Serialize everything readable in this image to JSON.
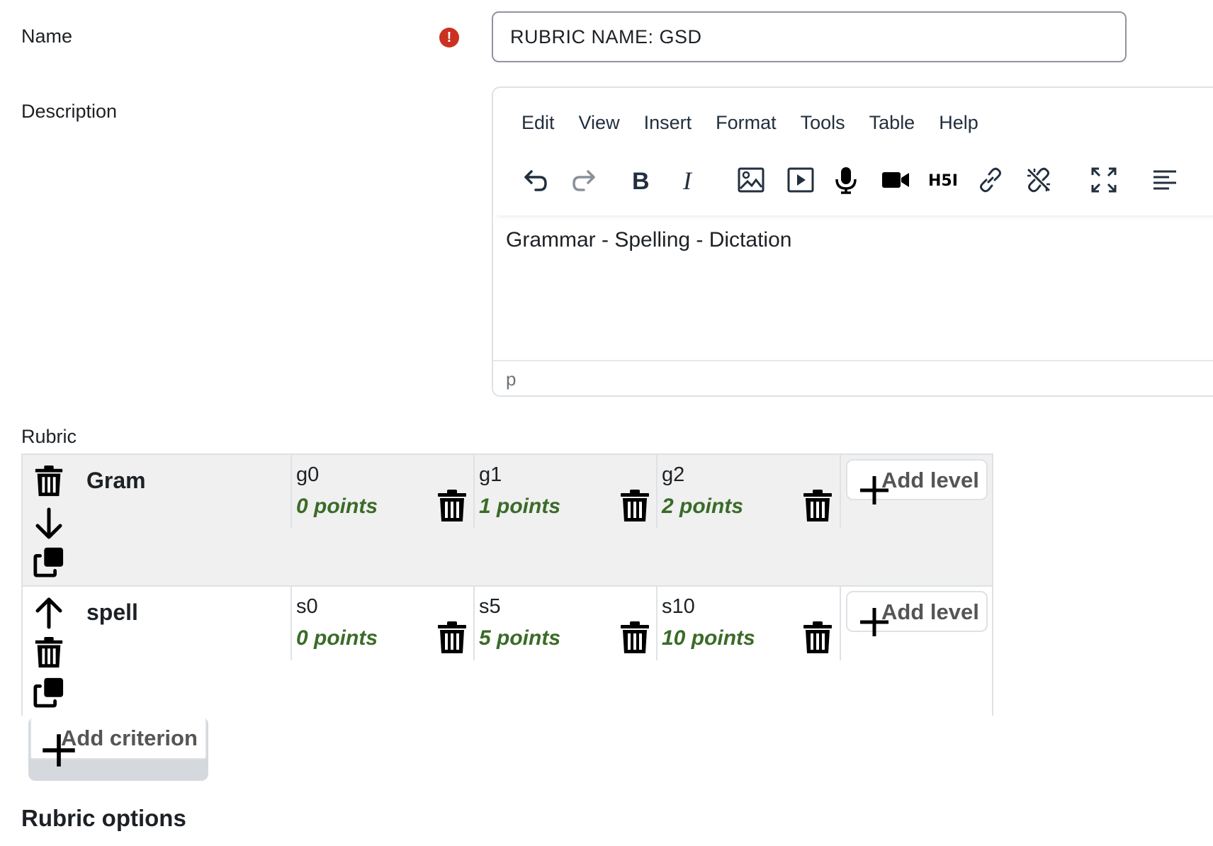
{
  "form": {
    "name_label": "Name",
    "name_value": "RUBRIC NAME: GSD",
    "description_label": "Description",
    "rubric_label": "Rubric",
    "rubric_options_title": "Rubric options"
  },
  "editor": {
    "menu": [
      "Edit",
      "View",
      "Insert",
      "Format",
      "Tools",
      "Table",
      "Help"
    ],
    "content": "Grammar - Spelling - Dictation",
    "status_path": "p",
    "toolbar_icons": [
      "undo-icon",
      "redo-icon",
      "bold-icon",
      "italic-icon",
      "image-icon",
      "media-icon",
      "microphone-icon",
      "video-camera-icon",
      "h5p-icon",
      "link-icon",
      "unlink-icon",
      "fullscreen-icon",
      "align-icon"
    ]
  },
  "rubric": {
    "add_level_label": "Add level",
    "add_criterion_label": "Add criterion",
    "criteria": [
      {
        "name": "Gram",
        "levels": [
          {
            "definition": "g0",
            "points": "0 points"
          },
          {
            "definition": "g1",
            "points": "1 points"
          },
          {
            "definition": "g2",
            "points": "2 points"
          }
        ]
      },
      {
        "name": "spell",
        "levels": [
          {
            "definition": "s0",
            "points": "0 points"
          },
          {
            "definition": "s5",
            "points": "5 points"
          },
          {
            "definition": "s10",
            "points": "10 points"
          }
        ]
      }
    ]
  },
  "colors": {
    "required": "#ca3120",
    "points": "#3a6b28",
    "row_shade": "#f0f0f0"
  }
}
